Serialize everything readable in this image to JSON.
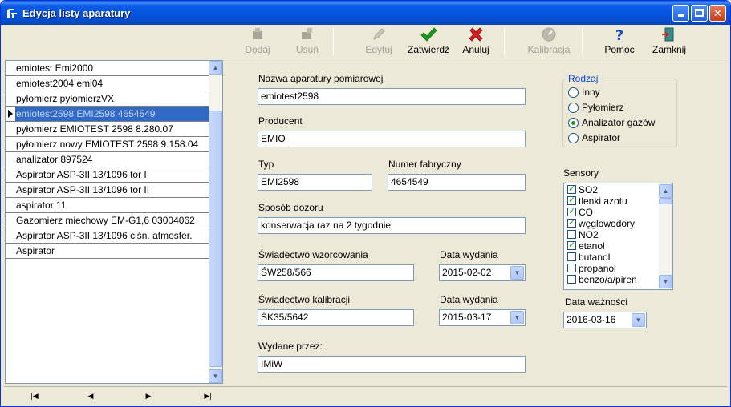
{
  "window": {
    "title": "Edycja listy aparatury"
  },
  "toolbar": {
    "items": [
      {
        "label": "Dodaj",
        "enabled": false,
        "icon": "add-device-icon"
      },
      {
        "label": "Usuń",
        "enabled": false,
        "icon": "remove-device-icon"
      },
      {
        "label": "Edytuj",
        "enabled": false,
        "icon": "edit-pencil-icon"
      },
      {
        "label": "Zatwierdź",
        "enabled": true,
        "icon": "green-check-icon"
      },
      {
        "label": "Anuluj",
        "enabled": true,
        "icon": "red-x-icon"
      },
      {
        "label": "Kalibracja",
        "enabled": false,
        "icon": "calibration-icon"
      },
      {
        "label": "Pomoc",
        "enabled": true,
        "icon": "help-question-icon"
      },
      {
        "label": "Zamknij",
        "enabled": true,
        "icon": "exit-door-icon"
      }
    ]
  },
  "list": {
    "items": [
      "emiotest Emi2000",
      "emiotest2004 emi04",
      "pyłomierz  pyłomierzVX",
      "emiotest2598 EMI2598 4654549",
      "pyłomierz EMIOTEST 2598 8.280.07",
      "pyłomierz nowy EMIOTEST 2598 9.158.04",
      "analizator  897524",
      "Aspirator ASP-3II 13/1096 tor I",
      "Aspirator ASP-3II 13/1096 tor II",
      "aspirator  11",
      "Gazomierz miechowy EM-G1,6 03004062",
      "Aspirator ASP-3II 13/1096 ciśn. atmosfer.",
      "Aspirator"
    ],
    "selected_index": 3
  },
  "form": {
    "name_label": "Nazwa aparatury pomiarowej",
    "name_value": "emiotest2598",
    "producer_label": "Producent",
    "producer_value": "EMIO",
    "type_label": "Typ",
    "type_value": "EMI2598",
    "serial_label": "Numer fabryczny",
    "serial_value": "4654549",
    "supervision_label": "Sposób dozoru",
    "supervision_value": "konserwacja raz na 2 tygodnie",
    "cert_label": "Świadectwo wzorcowania",
    "cert_value": "ŚW258/566",
    "cert_date_label": "Data wydania",
    "cert_date_value": "2015-02-02",
    "calib_label": "Świadectwo kalibracji",
    "calib_value": "ŚK35/5642",
    "calib_date_label": "Data wydania",
    "calib_date_value": "2015-03-17",
    "issued_by_label": "Wydane przez:",
    "issued_by_value": "IMiW"
  },
  "kind": {
    "legend": "Rodzaj",
    "options": [
      "Inny",
      "Pyłomierz",
      "Analizator gazów",
      "Aspirator"
    ],
    "selected_index": 2
  },
  "sensors": {
    "label": "Sensory",
    "items": [
      {
        "label": "SO2",
        "checked": true
      },
      {
        "label": "tlenki azotu",
        "checked": true
      },
      {
        "label": "CO",
        "checked": true
      },
      {
        "label": "węglowodory",
        "checked": true
      },
      {
        "label": "NO2",
        "checked": false
      },
      {
        "label": "etanol",
        "checked": true
      },
      {
        "label": "butanol",
        "checked": false
      },
      {
        "label": "propanol",
        "checked": false
      },
      {
        "label": "benzo/a/piren",
        "checked": false
      }
    ]
  },
  "validity": {
    "label": "Data ważności",
    "value": "2016-03-16"
  },
  "colors": {
    "selection": "#316ac5",
    "titlebar": "#0453dc",
    "check": "#21a121"
  }
}
